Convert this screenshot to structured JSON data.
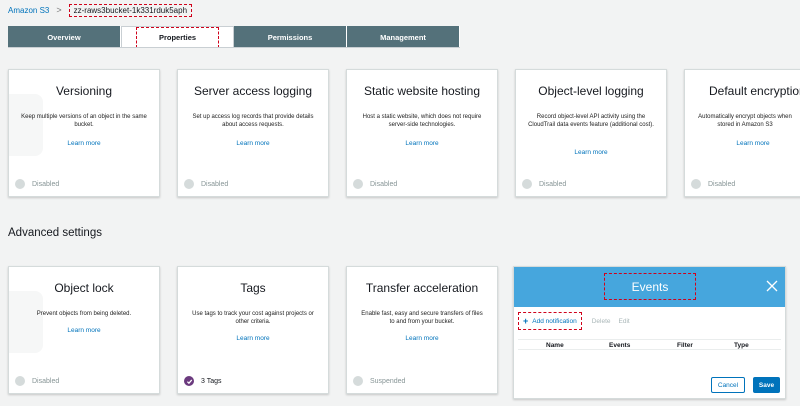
{
  "breadcrumb": {
    "root": "Amazon S3",
    "separator": ">",
    "current": "zz-raws3bucket-1k331rduk5aph"
  },
  "tabs": [
    {
      "label": "Overview",
      "active": false
    },
    {
      "label": "Properties",
      "active": true
    },
    {
      "label": "Permissions",
      "active": false
    },
    {
      "label": "Management",
      "active": false
    }
  ],
  "top_cards": [
    {
      "title": "Versioning",
      "description": "Keep multiple versions of an object in the same bucket.",
      "link": "Learn more",
      "status": "Disabled"
    },
    {
      "title": "Server access logging",
      "description": "Set up access log records that provide details about access requests.",
      "link": "Learn more",
      "status": "Disabled"
    },
    {
      "title": "Static website hosting",
      "description": "Host a static website, which does not require server-side technologies.",
      "link": "Learn more",
      "status": "Disabled"
    },
    {
      "title": "Object-level logging",
      "description": "Record object-level API activity using the CloudTrail data events feature (additional cost).",
      "link": "Learn more",
      "status": "Disabled"
    },
    {
      "title": "Default encryption",
      "description": "Automatically encrypt objects when stored in Amazon S3",
      "link": "Learn more",
      "status": "Disabled"
    }
  ],
  "advanced": {
    "heading": "Advanced settings",
    "cards": [
      {
        "title": "Object lock",
        "description": "Prevent objects from being deleted.",
        "link": "Learn more",
        "status": "Disabled"
      },
      {
        "title": "Tags",
        "description": "Use tags to track your cost against projects or other criteria.",
        "link": "Learn more",
        "status": "3 Tags"
      },
      {
        "title": "Transfer acceleration",
        "description": "Enable fast, easy and secure transfers of files to and from your bucket.",
        "link": "Learn more",
        "status": "Suspended"
      }
    ]
  },
  "events_panel": {
    "title": "Events",
    "add_label": "Add notification",
    "delete_label": "Delete",
    "edit_label": "Edit",
    "columns": [
      "Name",
      "Events",
      "Filter",
      "Type"
    ],
    "cancel_label": "Cancel",
    "save_label": "Save"
  },
  "colors": {
    "tab_bg": "#54717a",
    "link": "#0073bb",
    "events_header": "#46a6dd",
    "annotation": "#d0021b",
    "tag_check": "#6b3a7e"
  }
}
